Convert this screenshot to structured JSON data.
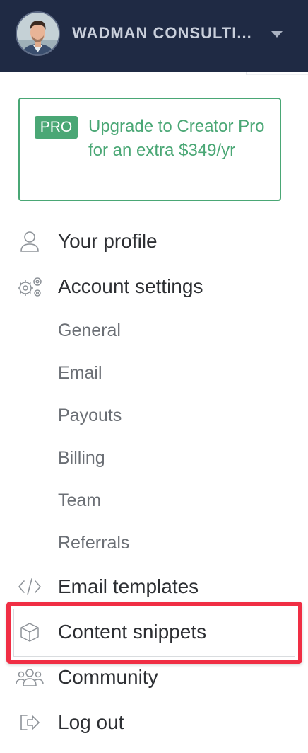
{
  "header": {
    "account_name": "WADMAN CONSULTI...",
    "caret_icon": "caret-down-icon"
  },
  "promo": {
    "badge": "PRO",
    "text": "Upgrade to Creator Pro for an extra $349/yr",
    "accent_color": "#4aa775"
  },
  "menu": {
    "profile": {
      "label": "Your profile",
      "icon": "user-icon"
    },
    "account_settings": {
      "label": "Account settings",
      "icon": "gears-icon",
      "subitems": [
        "General",
        "Email",
        "Payouts",
        "Billing",
        "Team",
        "Referrals"
      ]
    },
    "email_templates": {
      "label": "Email templates",
      "icon": "code-icon"
    },
    "content_snippets": {
      "label": "Content snippets",
      "icon": "cube-icon",
      "highlighted": true
    },
    "community": {
      "label": "Community",
      "icon": "users-icon"
    },
    "logout": {
      "label": "Log out",
      "icon": "sign-out-icon"
    }
  },
  "colors": {
    "header_bg": "#1f2a44",
    "highlight": "#f02e44",
    "text_primary": "#2d2f33",
    "text_secondary": "#6b6f75"
  }
}
